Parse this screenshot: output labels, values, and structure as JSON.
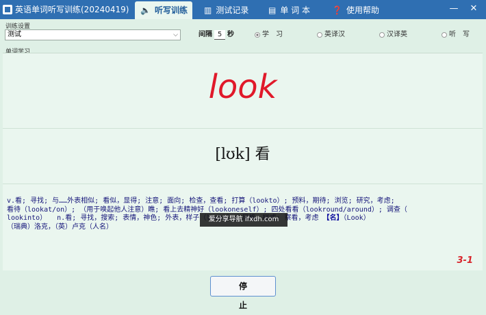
{
  "app": {
    "title": "英语单词听写训练(20240419)"
  },
  "tabs": [
    {
      "label": "听写训练",
      "icon": "speaker-icon",
      "active": true
    },
    {
      "label": "测试记录",
      "icon": "bar-chart-icon",
      "active": false
    },
    {
      "label": "单 词 本",
      "icon": "book-icon",
      "active": false
    },
    {
      "label": "使用帮助",
      "icon": "help-icon",
      "active": false
    }
  ],
  "window": {
    "minimize": "—",
    "close": "✕"
  },
  "settings": {
    "group_label": "训练设置",
    "wordbook": "测试",
    "interval_label": "间隔",
    "interval_value": "5",
    "interval_unit": "秒",
    "modes": [
      {
        "label": "学　习",
        "selected": true
      },
      {
        "label": "英译汉",
        "selected": false
      },
      {
        "label": "汉译英",
        "selected": false
      },
      {
        "label": "听　写",
        "selected": false
      }
    ]
  },
  "study": {
    "group_label": "单词学习",
    "word": "look",
    "phonetic": "[lʊk] 看",
    "definition_line1": "v.看; 寻找; 与……外表相似; 看似，显得; 注意; 面向; 检查，查看; 打算（lookto）; 预料，期待; 浏览; 研究，考虑;",
    "definition_line2": "看待（lookat/on）; （用于唤起他人注意）瞧; 看上去精神好（lookoneself）; 四处看看（lookround/around）; 调查（",
    "definition_line3": "lookinto）　　n.看; 寻找，搜索; 表情，神色; 外表，样子（looks）; 风格，样式; 察看，考虑",
    "definition_tag": "【名】",
    "definition_line3_end": "（Look）",
    "definition_line4": "（瑞典）洛克，（英）卢克（人名）",
    "counter": "3-1"
  },
  "watermark": "爱分享导航 ifxdh.com",
  "actions": {
    "stop_label": "停止"
  }
}
